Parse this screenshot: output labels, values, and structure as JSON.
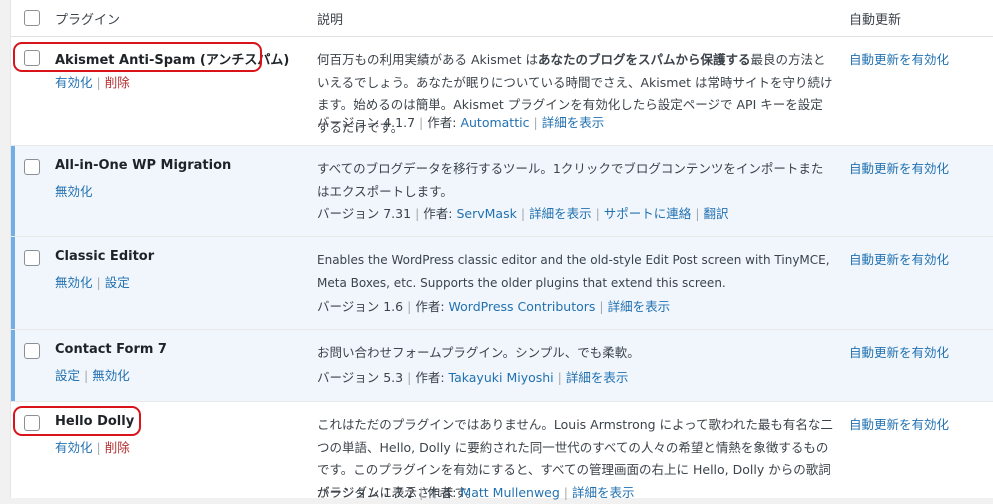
{
  "header": {
    "plugin_col": "プラグイン",
    "desc_col": "説明",
    "auto_col": "自動更新"
  },
  "plugins": [
    {
      "name": "Akismet Anti-Spam (アンチスパム)",
      "actions": [
        "有効化",
        "削除"
      ],
      "desc_pre": "何百万もの利用実績がある Akismet は",
      "desc_bold": "あなたのブログをスパムから保護する",
      "desc_post": "最良の方法といえるでしょう。あなたが眠りについている時間でさえ、Akismet は常時サイトを守り続けます。始めるのは簡単。Akismet プラグインを有効化したら設定ページで API キーを設定するだけです。",
      "version": "バージョン 4.1.7",
      "author_label": "作者:",
      "author": "Automattic",
      "links": [
        "詳細を表示"
      ],
      "auto": "自動更新を有効化"
    },
    {
      "name": "All-in-One WP Migration",
      "actions": [
        "無効化"
      ],
      "desc": "すべてのブログデータを移行するツール。1クリックでブログコンテンツをインポートまたはエクスポートします。",
      "version": "バージョン 7.31",
      "author_label": "作者:",
      "author": "ServMask",
      "links": [
        "詳細を表示",
        "サポートに連絡",
        "翻訳"
      ],
      "auto": "自動更新を有効化"
    },
    {
      "name": "Classic Editor",
      "actions": [
        "無効化",
        "設定"
      ],
      "desc": "Enables the WordPress classic editor and the old-style Edit Post screen with TinyMCE, Meta Boxes, etc. Supports the older plugins that extend this screen.",
      "version": "バージョン 1.6",
      "author_label": "作者:",
      "author": "WordPress Contributors",
      "links": [
        "詳細を表示"
      ],
      "auto": "自動更新を有効化"
    },
    {
      "name": "Contact Form 7",
      "actions": [
        "設定",
        "無効化"
      ],
      "desc": "お問い合わせフォームプラグイン。シンプル、でも柔軟。",
      "version": "バージョン 5.3",
      "author_label": "作者:",
      "author": "Takayuki Miyoshi",
      "links": [
        "詳細を表示"
      ],
      "auto": "自動更新を有効化"
    },
    {
      "name": "Hello Dolly",
      "actions": [
        "有効化",
        "削除"
      ],
      "desc": "これはただのプラグインではありません。Louis Armstrong によって歌われた最も有名な二つの単語、Hello, Dolly に要約された同一世代のすべての人々の希望と情熱を象徴するものです。このプラグインを有効にすると、すべての管理画面の右上に Hello, Dolly からの歌詞がランダムに表示されます。",
      "version": "バージョン 1.7.2",
      "author_label": "作者:",
      "author": "Matt Mullenweg",
      "links": [
        "詳細を表示"
      ],
      "auto": "自動更新を有効化"
    }
  ]
}
